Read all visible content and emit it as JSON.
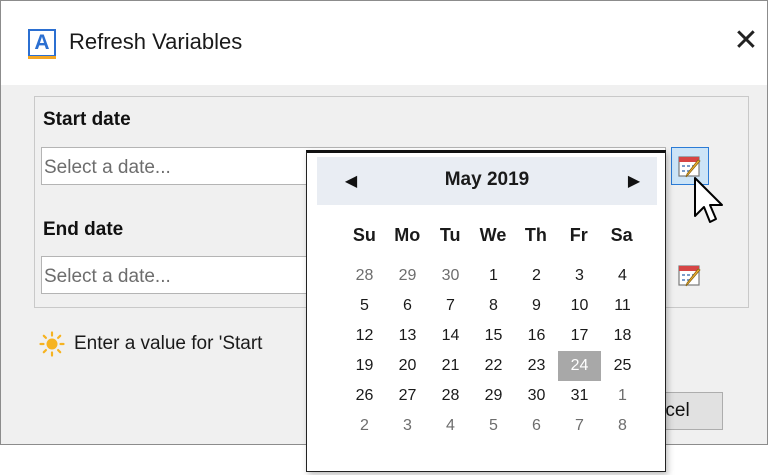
{
  "window": {
    "icon_letter": "A",
    "title": "Refresh Variables",
    "close_glyph": "✕"
  },
  "fields": {
    "start": {
      "label": "Start date",
      "placeholder": "Select a date..."
    },
    "end": {
      "label": "End date",
      "placeholder": "Select a date..."
    }
  },
  "status": {
    "icon": "sun-icon",
    "message": "Enter a value for 'Start"
  },
  "buttons": {
    "cancel_label": "ancel"
  },
  "calendar": {
    "month_label": "May 2019",
    "prev_glyph": "◀",
    "next_glyph": "▶",
    "weekdays": [
      "Su",
      "Mo",
      "Tu",
      "We",
      "Th",
      "Fr",
      "Sa"
    ],
    "selected_day": "24",
    "weeks": [
      [
        {
          "d": "28",
          "other": true
        },
        {
          "d": "29",
          "other": true
        },
        {
          "d": "30",
          "other": true
        },
        {
          "d": "1"
        },
        {
          "d": "2"
        },
        {
          "d": "3"
        },
        {
          "d": "4"
        }
      ],
      [
        {
          "d": "5"
        },
        {
          "d": "6"
        },
        {
          "d": "7"
        },
        {
          "d": "8"
        },
        {
          "d": "9"
        },
        {
          "d": "10"
        },
        {
          "d": "11"
        }
      ],
      [
        {
          "d": "12"
        },
        {
          "d": "13"
        },
        {
          "d": "14"
        },
        {
          "d": "15"
        },
        {
          "d": "16"
        },
        {
          "d": "17"
        },
        {
          "d": "18"
        }
      ],
      [
        {
          "d": "19"
        },
        {
          "d": "20"
        },
        {
          "d": "21"
        },
        {
          "d": "22"
        },
        {
          "d": "23"
        },
        {
          "d": "24",
          "selected": true
        },
        {
          "d": "25"
        }
      ],
      [
        {
          "d": "26"
        },
        {
          "d": "27"
        },
        {
          "d": "28"
        },
        {
          "d": "29"
        },
        {
          "d": "30"
        },
        {
          "d": "31"
        },
        {
          "d": "1",
          "other": true
        }
      ],
      [
        {
          "d": "2",
          "other": true
        },
        {
          "d": "3",
          "other": true
        },
        {
          "d": "4",
          "other": true
        },
        {
          "d": "5",
          "other": true
        },
        {
          "d": "6",
          "other": true
        },
        {
          "d": "7",
          "other": true
        },
        {
          "d": "8",
          "other": true
        }
      ]
    ]
  },
  "colors": {
    "accent": "#2b6fd1",
    "selected_day_bg": "#a8a8a8",
    "calendar_header_bg": "#e9edf3",
    "dialog_bg": "#f0f0f0"
  }
}
